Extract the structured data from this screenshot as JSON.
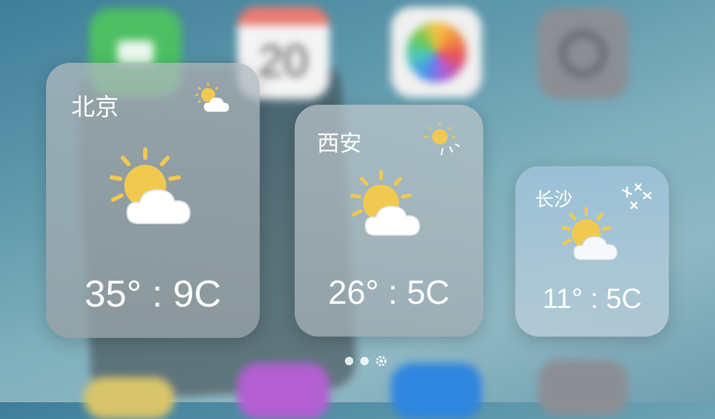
{
  "home_screen": {
    "calendar_day": "20"
  },
  "widgets": [
    {
      "city": "北京",
      "temperature": "35° : 9C",
      "corner_icon": "sun-behind-cloud-icon",
      "main_icon": "partly-cloudy-icon"
    },
    {
      "city": "西安",
      "temperature": "26° : 5C",
      "corner_icon": "sun-icon",
      "main_icon": "partly-cloudy-icon"
    },
    {
      "city": "长沙",
      "temperature": "11° : 5C",
      "corner_icon": "snow-sparkle-icon",
      "main_icon": "partly-cloudy-icon"
    }
  ],
  "page_indicator": {
    "pages": 3,
    "current": 1
  },
  "colors": {
    "sun": "#f1c94e",
    "cloud": "#ffffff",
    "text": "#ffffff"
  }
}
